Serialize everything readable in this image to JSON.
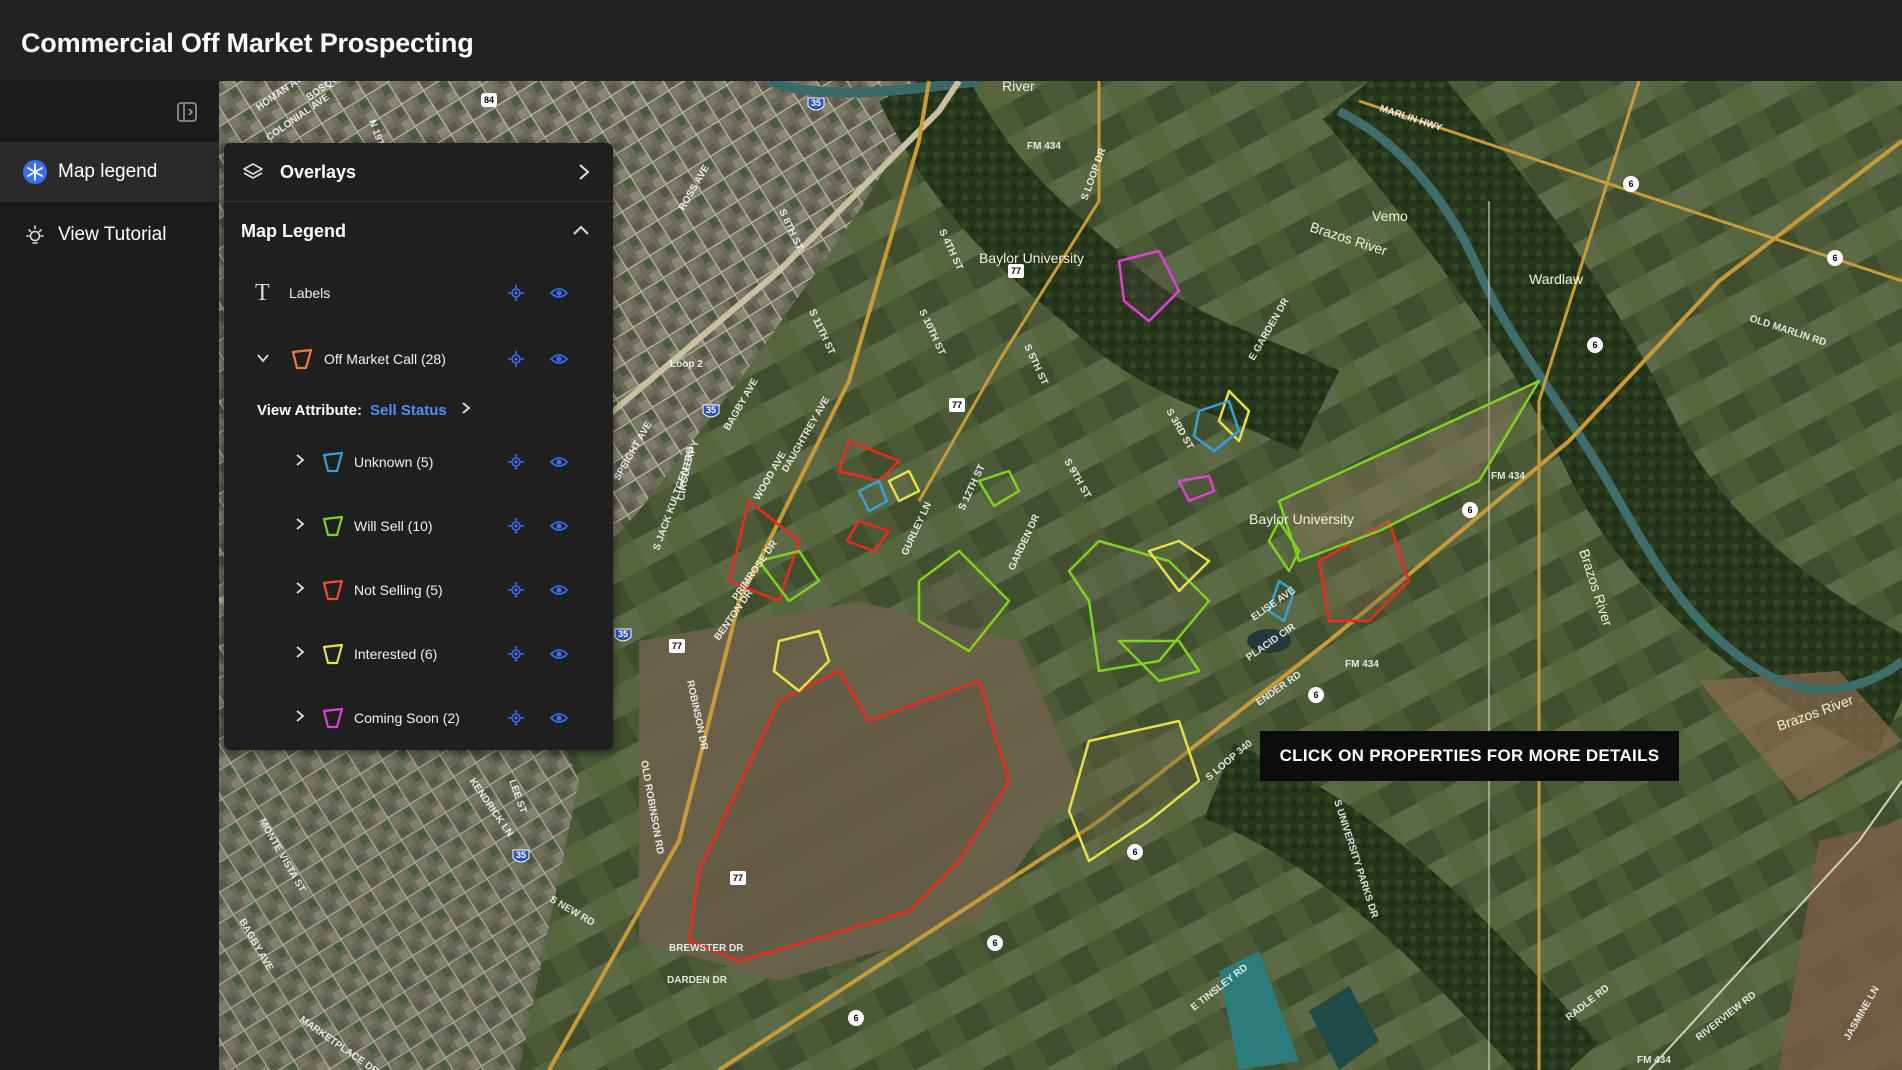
{
  "app": {
    "title": "Commercial Off Market Prospecting"
  },
  "sidebar": {
    "collapse_icon": "sidebar-collapse-icon",
    "items": [
      {
        "label": "Map legend",
        "icon": "snowflake-icon",
        "active": true
      },
      {
        "label": "View Tutorial",
        "icon": "lightbulb-icon",
        "active": false
      }
    ]
  },
  "panel": {
    "overlays": {
      "label": "Overlays",
      "icon": "layers-icon"
    },
    "legend": {
      "label": "Map Legend",
      "labels_layer": {
        "label": "Labels",
        "icon": "text-icon"
      },
      "main_layer": {
        "label": "Off Market Call (28)",
        "color": "#f07a3a"
      },
      "view_attribute": {
        "key": "View Attribute:",
        "value": "Sell Status"
      },
      "categories": [
        {
          "label": "Unknown (5)",
          "color": "#3aa0d8"
        },
        {
          "label": "Will Sell (10)",
          "color": "#7ed321"
        },
        {
          "label": "Not Selling (5)",
          "color": "#f04a3a"
        },
        {
          "label": "Interested (6)",
          "color": "#e8e04a"
        },
        {
          "label": "Coming Soon (2)",
          "color": "#e040d8"
        }
      ]
    }
  },
  "map": {
    "tooltip": "CLICK ON PROPERTIES FOR MORE DETAILS",
    "place_labels": [
      "Baylor University",
      "Baylor University",
      "Wardlaw",
      "Vemo",
      "Brazos River",
      "Brazos River",
      "Brazos River",
      "River"
    ],
    "road_labels": [
      "FM 434",
      "FM 434",
      "FM 434",
      "FM 434",
      "Loop 2",
      "S LOOP DR",
      "MARLIN HWY",
      "OLD MARLIN RD",
      "S 3RD ST",
      "ELISE AVE",
      "PLACID CIR",
      "ENDER RD",
      "S LOOP 340",
      "S UNIVERSITY PARKS DR",
      "E TINSLEY RD",
      "RADLE RD",
      "RIVERVIEW RD",
      "OLD ROBINSON RD",
      "ROBINSON DR",
      "BREWSTER DR",
      "DARDEN DR",
      "S NEW RD",
      "MARKETPLACE DR",
      "KENDRICK LN",
      "S JACK KULTGEN EXPY",
      "SPEIGHT AVE",
      "DAUGHTREY AVE",
      "GURLEY LN",
      "GARDEN DR",
      "E GARDEN DR",
      "S 5TH ST",
      "S 9TH ST",
      "BAGBY AVE",
      "WOOD AVE",
      "CIRCLE RD",
      "PRIMROSE DR",
      "BENTON DR",
      "S 12TH ST",
      "S 11TH ST",
      "S 10TH ST",
      "S 8TH ST",
      "S 4TH ST",
      "ROSS AVE",
      "HOMAN AVE",
      "BOSQUE",
      "COLONIAL AVE",
      "N 19TH ST",
      "JASMINE LN",
      "LEE ST",
      "MONTE VISTA ST",
      "BAGBY AVE"
    ],
    "shield_labels": [
      "84",
      "35",
      "77",
      "35",
      "35",
      "35",
      "77",
      "77",
      "77",
      "6",
      "6",
      "6",
      "6",
      "6",
      "6",
      "6",
      "6"
    ]
  }
}
